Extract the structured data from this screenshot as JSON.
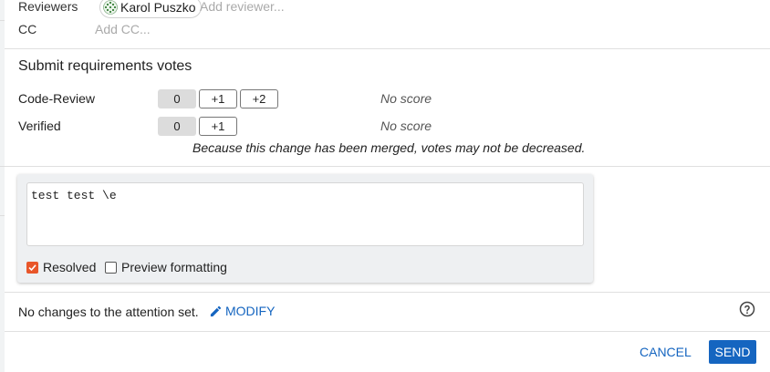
{
  "reviewers": {
    "label": "Reviewers",
    "chip_name": "Karol Puszko",
    "add_placeholder": "Add reviewer..."
  },
  "cc": {
    "label": "CC",
    "add_placeholder": "Add CC..."
  },
  "votes": {
    "title": "Submit requirements votes",
    "code_review": {
      "label": "Code-Review",
      "buttons": [
        "0",
        "+1",
        "+2"
      ],
      "selected": "0",
      "score": "No score"
    },
    "verified": {
      "label": "Verified",
      "buttons": [
        "0",
        "+1"
      ],
      "selected": "0",
      "score": "No score"
    },
    "merged_note": "Because this change has been merged, votes may not be decreased."
  },
  "comment": {
    "text": "test test \\e",
    "resolved_label": "Resolved",
    "resolved_checked": true,
    "preview_label": "Preview formatting",
    "preview_checked": false
  },
  "attention": {
    "text": "No changes to the attention set.",
    "modify_label": "MODIFY"
  },
  "actions": {
    "cancel": "CANCEL",
    "send": "SEND"
  },
  "colors": {
    "accent": "#1565c0",
    "checkbox": "#e8562a",
    "selected_vote": "#dcdcdc"
  },
  "icons": {
    "avatar": "avatar-icon",
    "modify": "pencil-icon",
    "help": "help-circle-icon",
    "check": "check-icon"
  }
}
